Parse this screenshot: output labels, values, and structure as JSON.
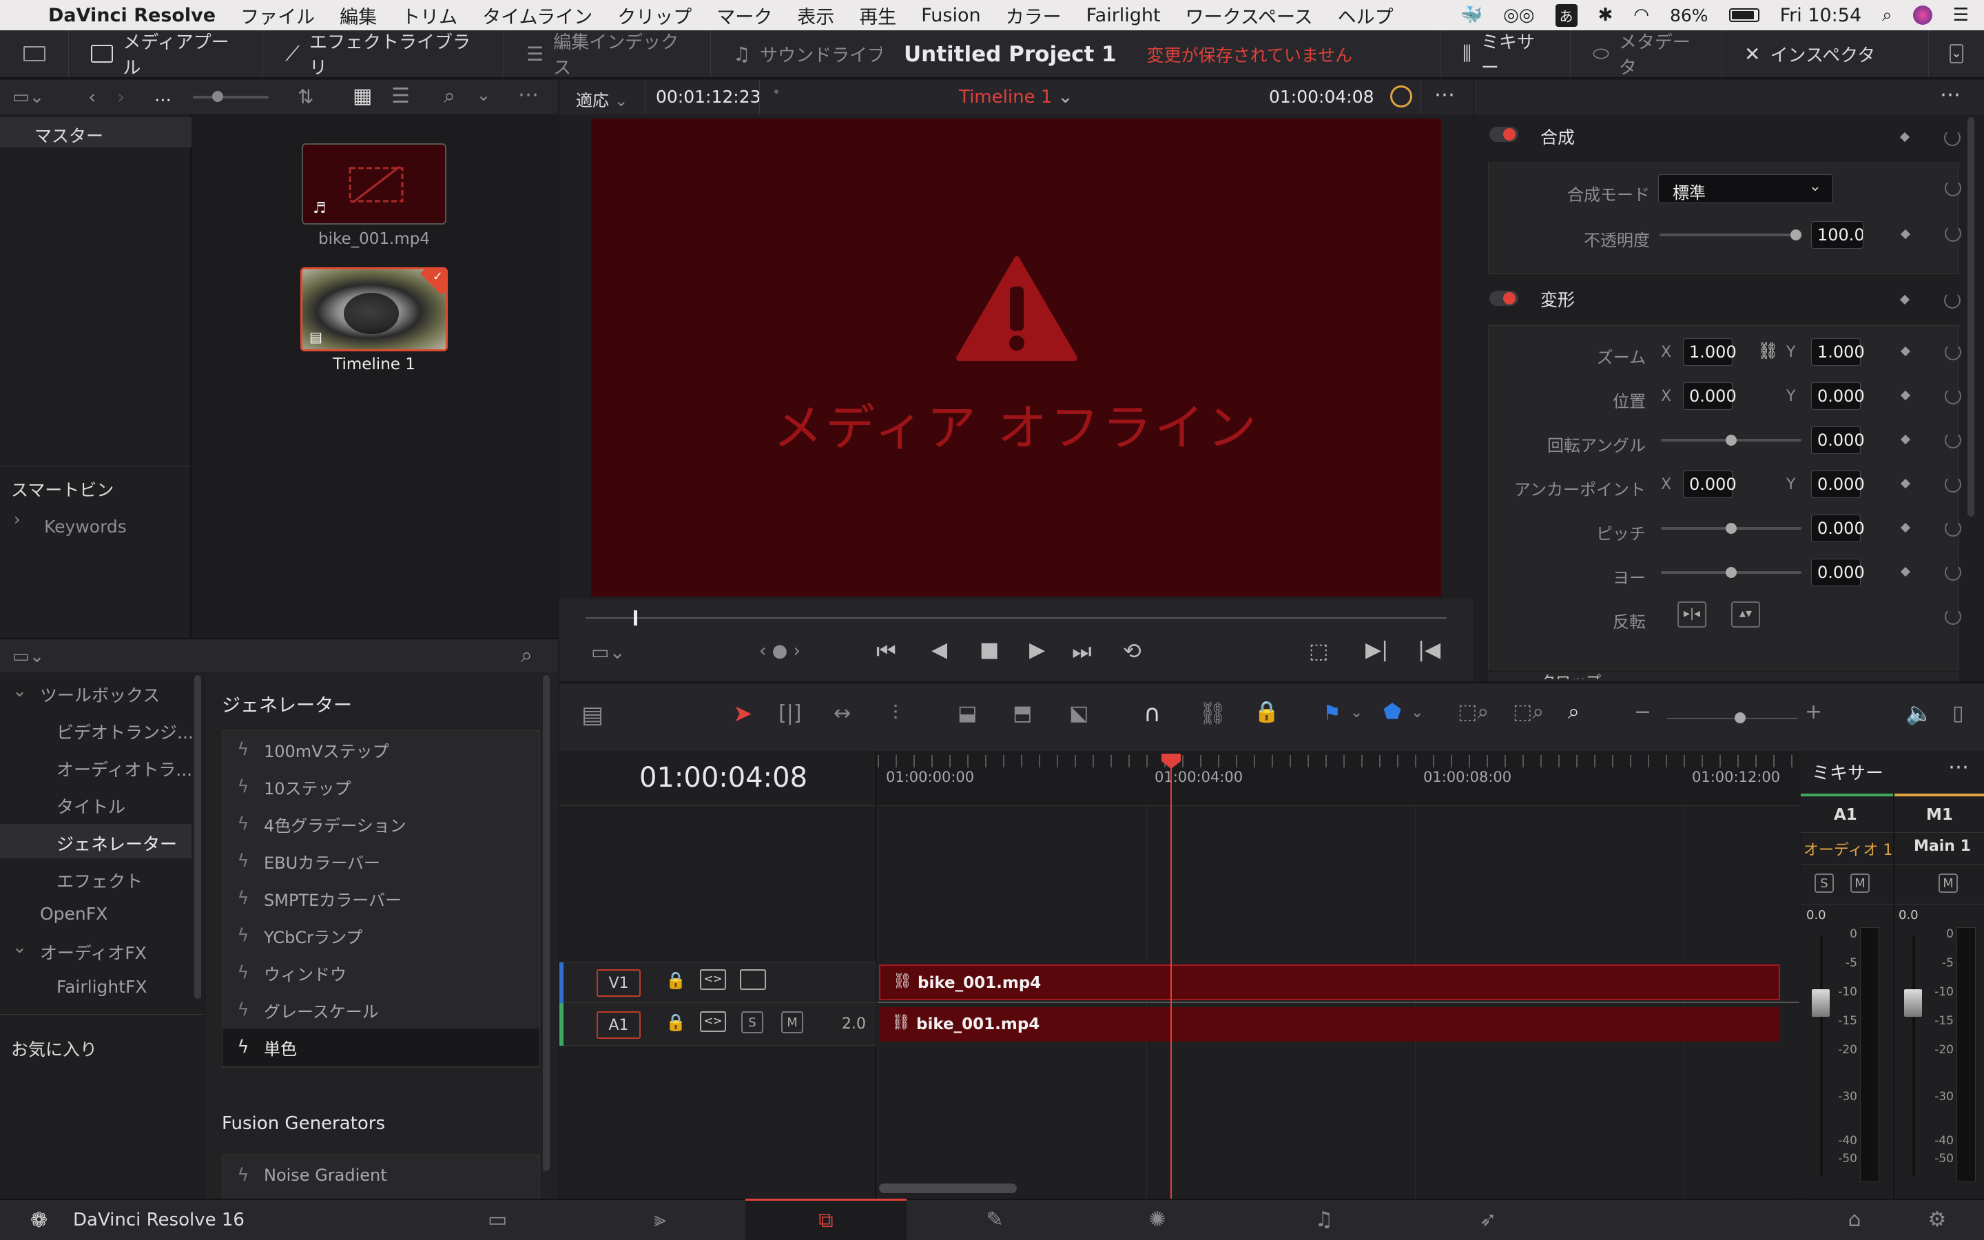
{
  "menubar": {
    "app": "DaVinci Resolve",
    "items": [
      "ファイル",
      "編集",
      "トリム",
      "タイムライン",
      "クリップ",
      "マーク",
      "表示",
      "再生",
      "Fusion",
      "カラー",
      "Fairlight",
      "ワークスペース",
      "ヘルプ"
    ],
    "battery": "86%",
    "clock": "Fri 10:54"
  },
  "toolbar": {
    "media_pool": "メディアプール",
    "effects_library": "エフェクトライブラリ",
    "edit_index": "編集インデックス",
    "sound_library": "サウンドライブラリ",
    "project_title": "Untitled Project 1",
    "unsaved": "変更が保存されていません",
    "mixer": "ミキサー",
    "metadata": "メタデータ",
    "inspector": "インスペクタ"
  },
  "media_pool": {
    "breadcrumb": "...",
    "master": "マスター",
    "smart_bins": "スマートビン",
    "keywords": "Keywords",
    "clips": [
      {
        "name": "bike_001.mp4"
      },
      {
        "name": "Timeline 1"
      }
    ]
  },
  "viewer": {
    "fit": "適応",
    "source_timecode": "00:01:12:23",
    "timeline_name": "Timeline 1",
    "record_timecode": "01:00:04:08",
    "offline_text": "メディア オフライン"
  },
  "inspector": {
    "composite": {
      "title": "合成",
      "mode_label": "合成モード",
      "mode_value": "標準",
      "opacity_label": "不透明度",
      "opacity_value": "100.00",
      "opacity_level": 1.0
    },
    "transform": {
      "title": "変形",
      "zoom_label": "ズーム",
      "zoom_x": "1.000",
      "zoom_y": "1.000",
      "position_label": "位置",
      "pos_x": "0.000",
      "pos_y": "0.000",
      "rotation_label": "回転アングル",
      "rotation_value": "0.000",
      "anchor_label": "アンカーポイント",
      "anchor_x": "0.000",
      "anchor_y": "0.000",
      "pitch_label": "ピッチ",
      "pitch_value": "0.000",
      "yaw_label": "ヨー",
      "yaw_value": "0.000",
      "flip_label": "反転",
      "x_label": "X",
      "y_label": "Y"
    },
    "next_section": "クロップ"
  },
  "effects": {
    "tree": {
      "toolbox": "ツールボックス",
      "video_transitions": "ビデオトランジ...",
      "audio_transitions": "オーディオトラ...",
      "titles": "タイトル",
      "generators": "ジェネレーター",
      "effects": "エフェクト",
      "openfx": "OpenFX",
      "audio_fx": "オーディオFX",
      "fairlight_fx": "FairlightFX",
      "favorites": "お気に入り"
    },
    "section_title": "ジェネレーター",
    "generators": [
      "100mVステップ",
      "10ステップ",
      "4色グラデーション",
      "EBUカラーバー",
      "SMPTEカラーバー",
      "YCbCrランプ",
      "ウィンドウ",
      "グレースケール",
      "単色"
    ],
    "fusion_title": "Fusion Generators",
    "fusion_items": [
      "Noise Gradient"
    ]
  },
  "timeline": {
    "timecode": "01:00:04:08",
    "ruler": [
      "01:00:00:00",
      "01:00:04:00",
      "01:00:08:00",
      "01:00:12:00"
    ],
    "v1": "V1",
    "a1": "A1",
    "a1_level": "2.0",
    "s": "S",
    "m": "M",
    "video_clip": "bike_001.mp4",
    "audio_clip": "bike_001.mp4"
  },
  "mixer": {
    "title": "ミキサー",
    "ch1": "A1",
    "ch2": "M1",
    "ch1_name": "オーディオ 1",
    "ch2_name": "Main 1",
    "s": "S",
    "m": "M",
    "db1": "0.0",
    "db2": "0.0",
    "scale": [
      "0",
      "-5",
      "-10",
      "-15",
      "-20",
      "-30",
      "-40",
      "-50"
    ]
  },
  "bottom": {
    "app_name": "DaVinci Resolve 16"
  },
  "colors": {
    "accent_red": "#e0413a",
    "offline_bg": "#3d0507",
    "clip_red": "#6b0b0f",
    "orange": "#e0a340"
  }
}
